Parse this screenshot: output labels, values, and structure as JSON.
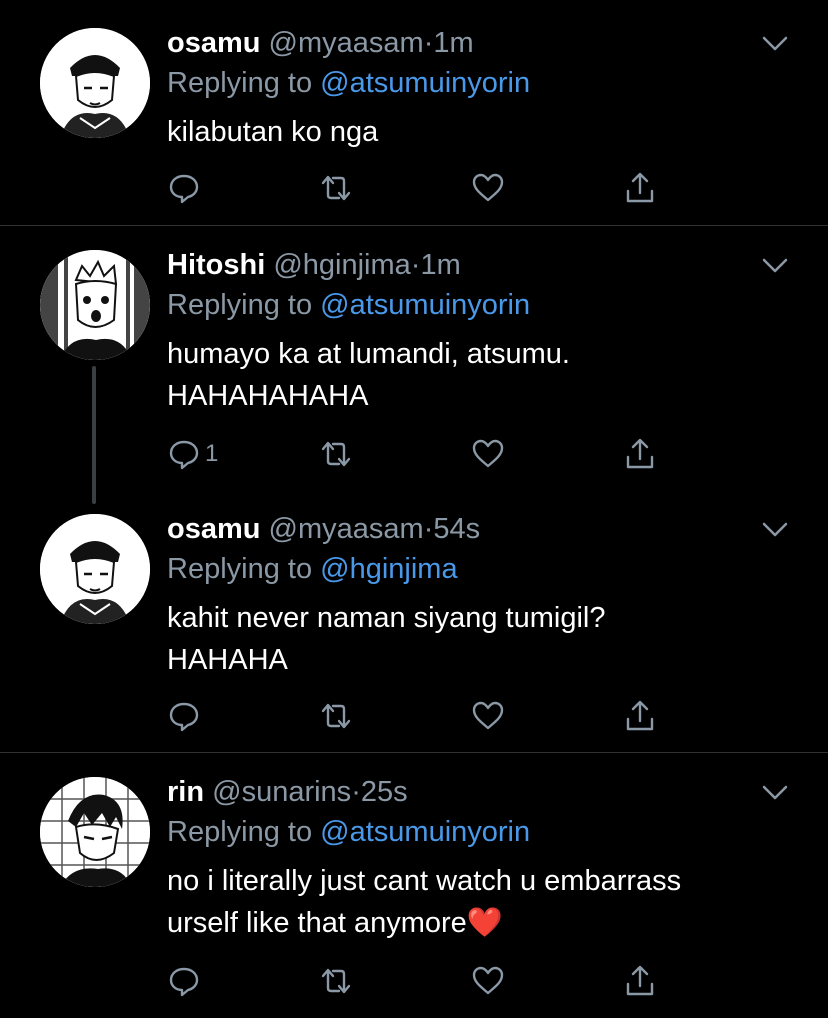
{
  "tweets": [
    {
      "name": "osamu",
      "handle": "@myaasam",
      "dot": "·",
      "time": "1m",
      "reply_prefix": "Replying to",
      "reply_to": "@atsumuinyorin",
      "text_lines": [
        "kilabutan ko nga"
      ],
      "reply_count": "",
      "avatar": "osamu-avatar"
    },
    {
      "name": "Hitoshi",
      "handle": "@hginjima",
      "dot": "·",
      "time": "1m",
      "reply_prefix": "Replying to",
      "reply_to": "@atsumuinyorin",
      "text_lines": [
        "humayo ka at lumandi, atsumu.",
        "HAHAHAHAHA"
      ],
      "reply_count": "1",
      "avatar": "hitoshi-avatar"
    },
    {
      "name": "osamu",
      "handle": "@myaasam",
      "dot": "·",
      "time": "54s",
      "reply_prefix": "Replying to",
      "reply_to": "@hginjima",
      "text_lines": [
        "kahit never naman siyang tumigil?",
        "HAHAHA"
      ],
      "reply_count": "",
      "avatar": "osamu-avatar"
    },
    {
      "name": "rin",
      "handle": "@sunarins",
      "dot": "·",
      "time": "25s",
      "reply_prefix": "Replying to",
      "reply_to": "@atsumuinyorin",
      "text_lines": [
        "no i literally just cant watch u embarrass",
        "urself like that anymore"
      ],
      "text_emoji": "❤️",
      "reply_count": "",
      "avatar": "rin-avatar"
    }
  ],
  "colors": {
    "background": "#000000",
    "secondary_text": "#8b98a5",
    "link": "#4a99e9",
    "divider": "#2f3336"
  },
  "icons": [
    "reply-icon",
    "retweet-icon",
    "like-icon",
    "share-icon",
    "chevron-down-icon"
  ]
}
